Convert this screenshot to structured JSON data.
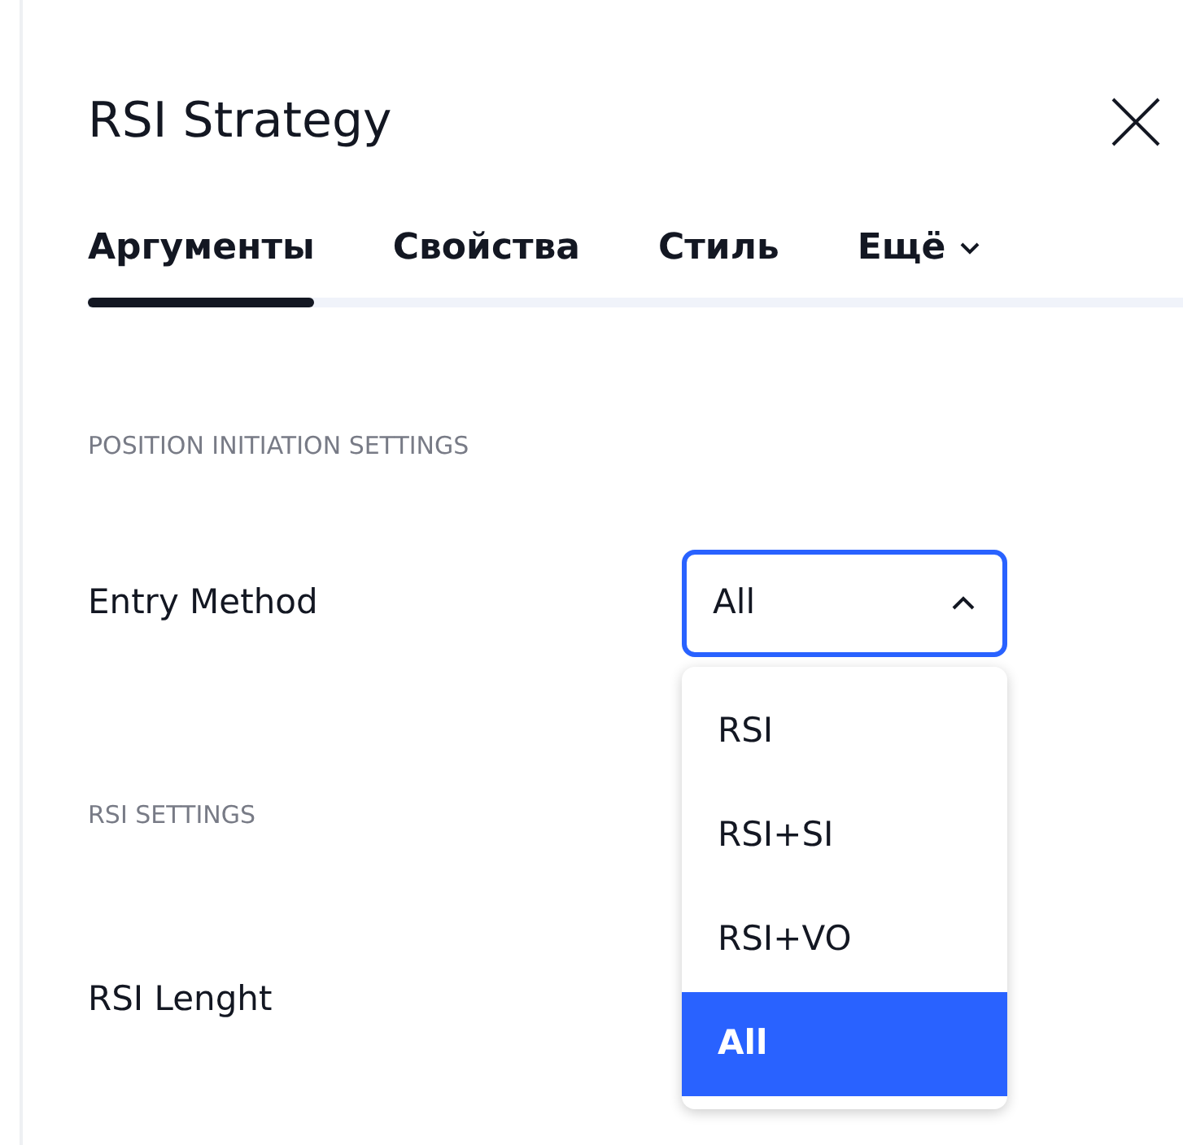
{
  "dialog": {
    "title": "RSI Strategy"
  },
  "tabs": [
    {
      "label": "Аргументы",
      "selected": true,
      "kind": "tab"
    },
    {
      "label": "Свойства",
      "selected": false,
      "kind": "tab"
    },
    {
      "label": "Стиль",
      "selected": false,
      "kind": "tab"
    },
    {
      "label": "Ещё",
      "selected": false,
      "kind": "more"
    }
  ],
  "sections": [
    {
      "header": "POSITION INITIATION SETTINGS",
      "fields": [
        {
          "label": "Entry Method",
          "kind": "select",
          "value": "All",
          "expanded": true,
          "options": [
            {
              "label": "RSI",
              "selected": false
            },
            {
              "label": "RSI+SI",
              "selected": false
            },
            {
              "label": "RSI+VO",
              "selected": false
            },
            {
              "label": "All",
              "selected": true
            }
          ]
        }
      ]
    },
    {
      "header": "RSI SETTINGS",
      "fields": [
        {
          "label": "RSI Lenght",
          "kind": "hidden"
        }
      ]
    }
  ]
}
